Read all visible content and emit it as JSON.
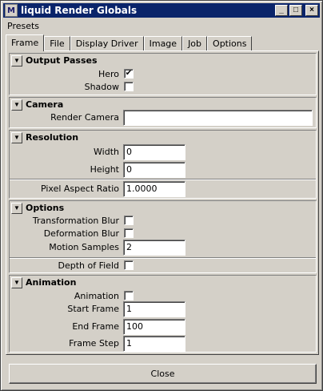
{
  "window": {
    "title": "liquid Render Globals",
    "app_icon": "M"
  },
  "menubar": {
    "items": [
      "Presets"
    ]
  },
  "tabs": [
    "Frame",
    "File",
    "Display Driver",
    "Image",
    "Job",
    "Options"
  ],
  "active_tab": "Frame",
  "sections": {
    "output_passes": {
      "title": "Output Passes",
      "hero_label": "Hero",
      "hero_checked": true,
      "shadow_label": "Shadow",
      "shadow_checked": false
    },
    "camera": {
      "title": "Camera",
      "render_camera_label": "Render Camera",
      "render_camera_value": ""
    },
    "resolution": {
      "title": "Resolution",
      "width_label": "Width",
      "width_value": "0",
      "height_label": "Height",
      "height_value": "0",
      "pixel_aspect_label": "Pixel Aspect Ratio",
      "pixel_aspect_value": "1.0000"
    },
    "options": {
      "title": "Options",
      "transformation_blur_label": "Transformation Blur",
      "transformation_blur_checked": false,
      "deformation_blur_label": "Deformation Blur",
      "deformation_blur_checked": false,
      "motion_samples_label": "Motion Samples",
      "motion_samples_value": "2",
      "depth_of_field_label": "Depth of Field",
      "depth_of_field_checked": false
    },
    "animation": {
      "title": "Animation",
      "animation_label": "Animation",
      "animation_checked": false,
      "start_frame_label": "Start Frame",
      "start_frame_value": "1",
      "end_frame_label": "End Frame",
      "end_frame_value": "100",
      "frame_step_label": "Frame Step",
      "frame_step_value": "1"
    }
  },
  "footer": {
    "close_label": "Close"
  },
  "glyphs": {
    "collapse": "▼",
    "check": "✔",
    "minimize": "_",
    "maximize": "□",
    "close": "×"
  }
}
